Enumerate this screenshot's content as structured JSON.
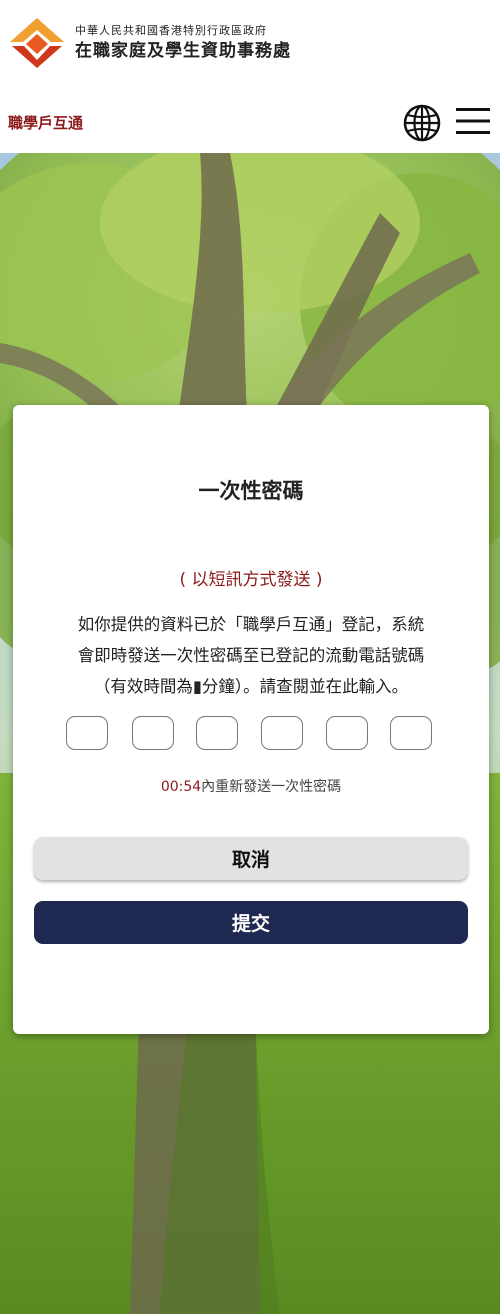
{
  "header": {
    "org_line1": "中華人民共和國香港特別行政區政府",
    "org_line2": "在職家庭及學生資助事務處",
    "app_name": "職學戶互通",
    "icons": {
      "language": "globe-icon",
      "menu": "hamburger-menu-icon",
      "logo": "wfsfaa-logo"
    }
  },
  "otp_card": {
    "title": "一次性密碼",
    "sms_note": "( 以短訊方式發送 )",
    "description_lines": [
      "如你提供的資料已於「職學戶互通」登記，系統",
      "會即時發送一次性密碼至已登記的流動電話號碼",
      "（有效時間為▮分鐘）。請查閱並在此輸入。"
    ],
    "otp_digits": [
      "",
      "",
      "",
      "",
      "",
      ""
    ],
    "resend_timer": "00:54",
    "resend_text": "內重新發送一次性密碼",
    "cancel_label": "取消",
    "submit_label": "提交"
  },
  "colors": {
    "brand_red": "#8b1a1a",
    "logo_orange": "#f0a030",
    "logo_red": "#d0381e",
    "submit_bg": "#1f2850",
    "cancel_bg": "#e2e2e2"
  }
}
